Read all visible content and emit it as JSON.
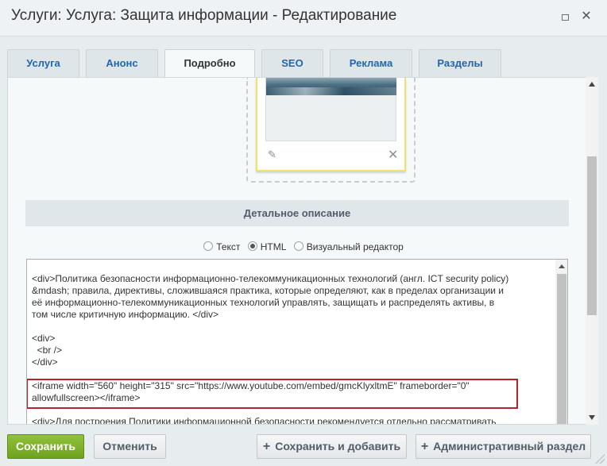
{
  "window": {
    "title": "Услуги: Услуга: Защита информации - Редактирование"
  },
  "tabs": [
    {
      "label": "Услуга"
    },
    {
      "label": "Анонс"
    },
    {
      "label": "Подробно"
    },
    {
      "label": "SEO"
    },
    {
      "label": "Реклама"
    },
    {
      "label": "Разделы"
    }
  ],
  "active_tab": "Подробно",
  "detail": {
    "section_title": "Детальное описание",
    "editor_modes": [
      {
        "label": "Текст",
        "checked": false
      },
      {
        "label": "HTML",
        "checked": true
      },
      {
        "label": "Визуальный редактор",
        "checked": false
      }
    ],
    "editor_lines": {
      "l1": "<div>Политика безопасности информационно-телекоммуникационных технологий (англ. ICT security policy)",
      "l2": "&mdash; правила, директивы, сложившаяся практика, которые определяют, как в пределах организации и",
      "l3": "её информационно-телекоммуникационных технологий управлять, защищать и распределять активы, в",
      "l4": "том числе критичную информацию. </div>",
      "l5": "<div>",
      "l6": "  <br />",
      "l7": "</div>",
      "l8": "<iframe width=\"560\" height=\"315\" src=\"https://www.youtube.com/embed/gmcKlyxltmE\" frameborder=\"0\"",
      "l9": "allowfullscreen></iframe>",
      "l10": "<div>Для построения Политики информационной безопасности рекомендуется отдельно рассматривать"
    },
    "highlight_color": "#b8232b"
  },
  "footer": {
    "save": "Сохранить",
    "cancel": "Отменить",
    "save_add": "Сохранить и добавить",
    "admin_section": "Административный раздел"
  },
  "colors": {
    "accent_green": "#7aac27",
    "tab_link": "#2067b0",
    "image_frame": "#f4e16a"
  }
}
